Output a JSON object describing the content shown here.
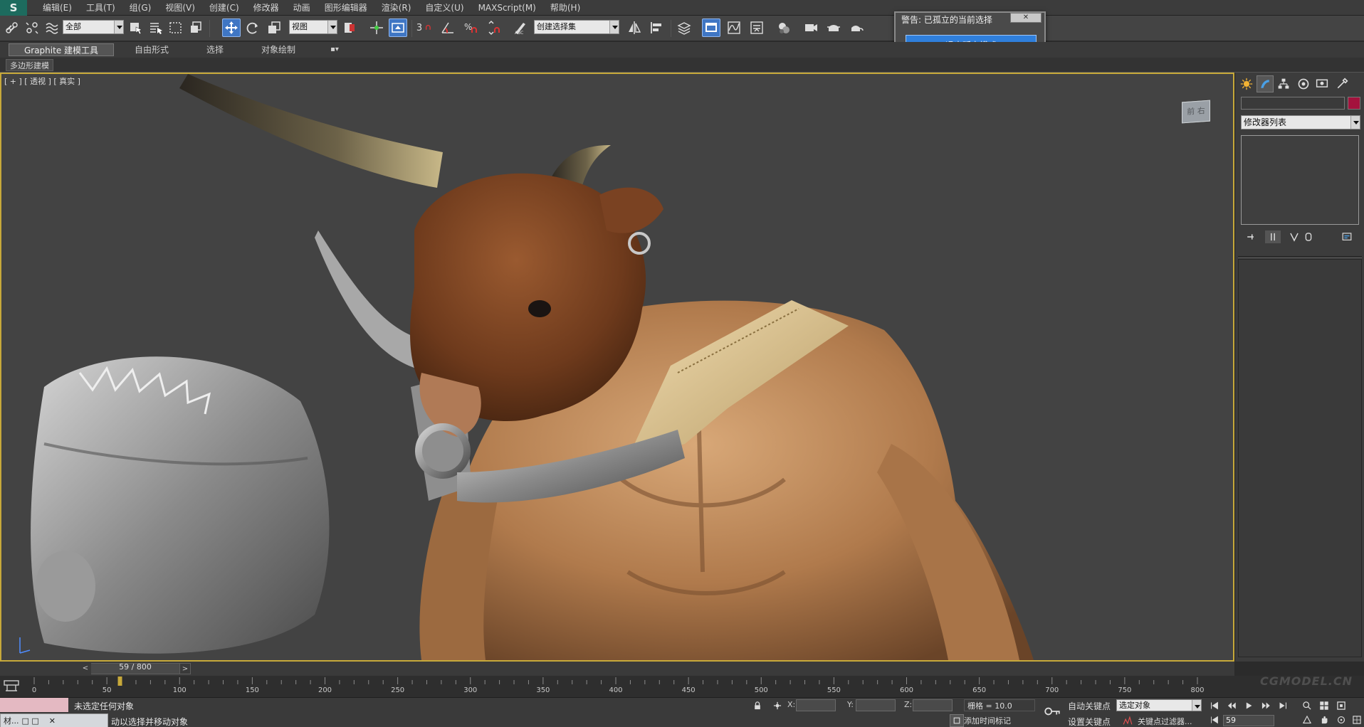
{
  "app": {
    "logo": "S"
  },
  "menu": {
    "items": [
      "编辑(E)",
      "工具(T)",
      "组(G)",
      "视图(V)",
      "创建(C)",
      "修改器",
      "动画",
      "图形编辑器",
      "渲染(R)",
      "自定义(U)",
      "MAXScript(M)",
      "帮助(H)"
    ]
  },
  "toolbar": {
    "filter_dropdown": "全部",
    "refcoord_dropdown": "视图",
    "selection_set_dropdown": "创建选择集",
    "snap_label": "3"
  },
  "ribbon": {
    "tabs": [
      "Graphite 建模工具",
      "自由形式",
      "选择",
      "对象绘制"
    ],
    "sub_label": "多边形建模"
  },
  "viewport": {
    "label": "[ + ] [ 透视 ] [ 真实 ]",
    "viewcube_label": "前 右"
  },
  "dialog": {
    "title": "警告: 已孤立的当前选择",
    "button": "退出孤立模式"
  },
  "command_panel": {
    "modifier_list": "修改器列表",
    "name_color": "#a4123d"
  },
  "timeslider": {
    "label": "59 / 800",
    "current_frame": 59,
    "total_frames": 800
  },
  "trackbar": {
    "ticks": [
      "0",
      "50",
      "100",
      "150",
      "200",
      "250",
      "300",
      "350",
      "400",
      "450",
      "500",
      "550",
      "600",
      "650",
      "700",
      "750",
      "800"
    ]
  },
  "status": {
    "selection_text": "未选定任何对象",
    "prompt_text": "单击并拖动以选择并移动对象",
    "prompt_text_visible": "动以选择并移动对象",
    "x_label": "X:",
    "y_label": "Y:",
    "z_label": "Z:",
    "grid": "栅格 = 10.0",
    "add_time_tag": "添加时间标记",
    "auto_key": "自动关键点",
    "set_key": "设置关键点",
    "selected_dropdown": "选定对象",
    "key_filters": "关键点过滤器...",
    "frame": "59",
    "taskbar_thumb": "材..."
  },
  "watermark": "CGMODEL.CN",
  "colors": {
    "accent_blue": "#3f76c4",
    "viewport_border": "#c7a93a",
    "dialog_button": "#2f7fdc"
  }
}
